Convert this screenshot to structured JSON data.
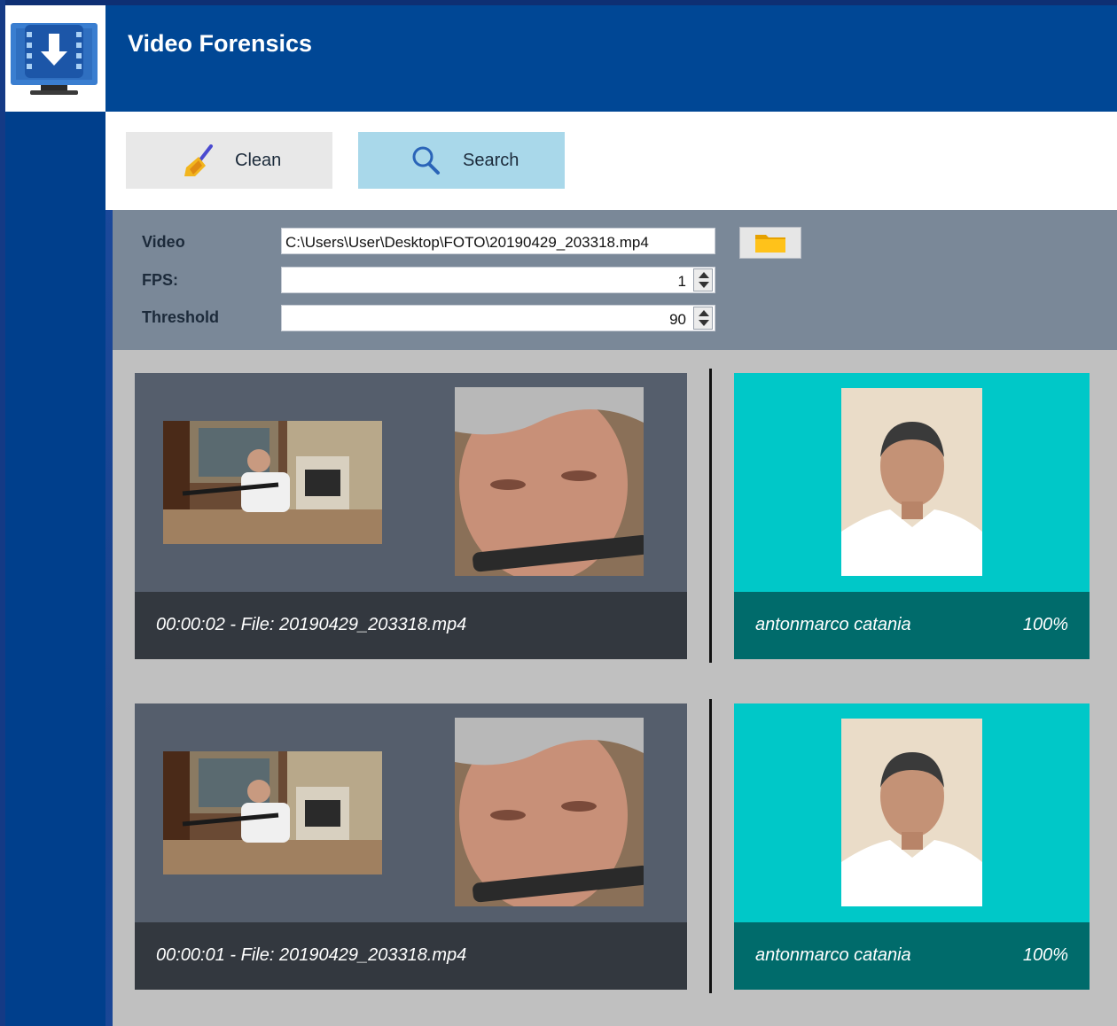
{
  "app": {
    "title": "Video Forensics"
  },
  "toolbar": {
    "clean_label": "Clean",
    "search_label": "Search"
  },
  "form": {
    "video_label": "Video",
    "video_value": "C:\\Users\\User\\Desktop\\FOTO\\20190429_203318.mp4",
    "fps_label": "FPS:",
    "fps_value": "1",
    "threshold_label": "Threshold",
    "threshold_value": "90"
  },
  "results": [
    {
      "caption": "00:00:02 - File: 20190429_203318.mp4",
      "match_name": "antonmarco catania",
      "match_score": "100%"
    },
    {
      "caption": "00:00:01 - File: 20190429_203318.mp4",
      "match_name": "antonmarco catania",
      "match_score": "100%"
    }
  ],
  "colors": {
    "titlebar": "#004795",
    "search_button": "#a9d8ea",
    "match_card": "#00c8c8",
    "match_caption": "#006b6b"
  }
}
